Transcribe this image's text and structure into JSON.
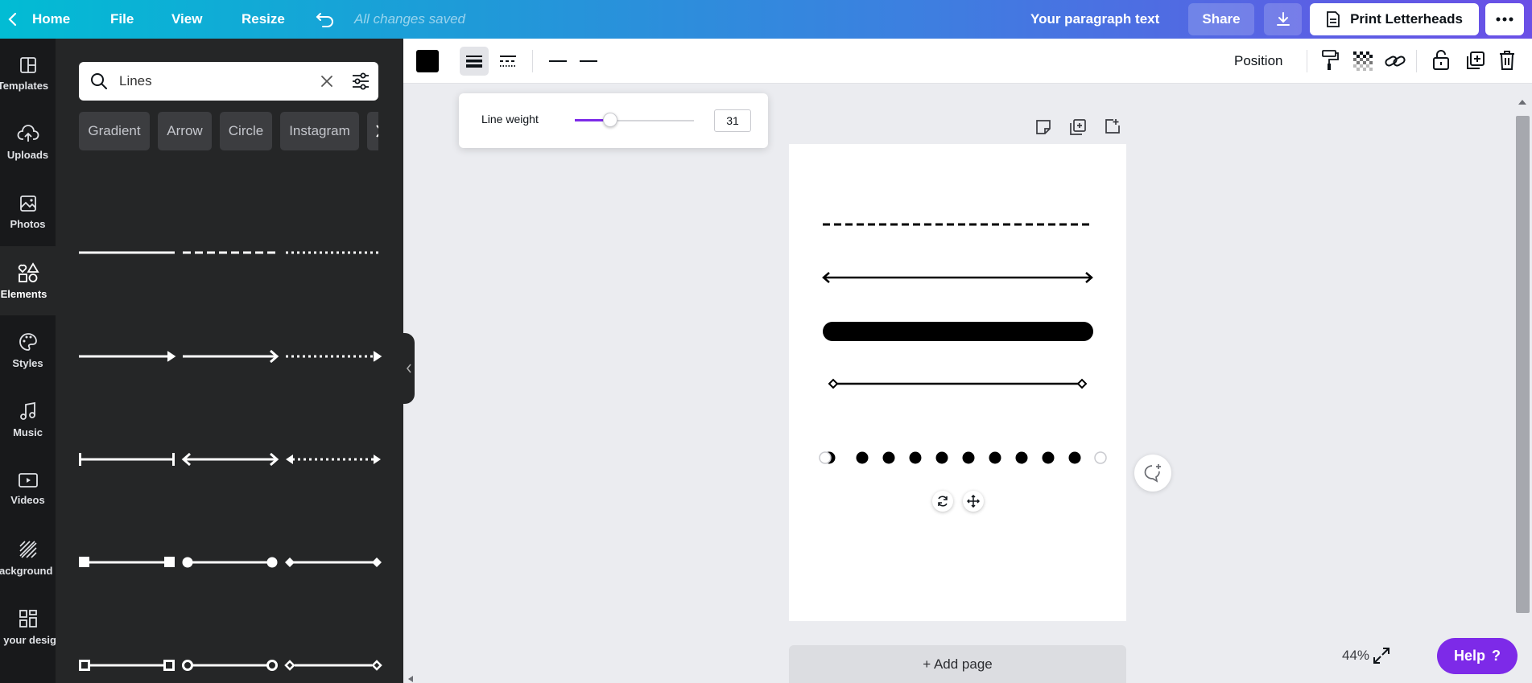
{
  "topbar": {
    "home_label": "Home",
    "file_label": "File",
    "view_label": "View",
    "resize_label": "Resize",
    "saved_status": "All changes saved",
    "doc_title": "Your paragraph text",
    "share_label": "Share",
    "print_label": "Print Letterheads"
  },
  "rail": {
    "items": [
      {
        "label": "Templates",
        "icon": "templates-icon"
      },
      {
        "label": "Uploads",
        "icon": "upload-cloud-icon"
      },
      {
        "label": "Photos",
        "icon": "photos-icon"
      },
      {
        "label": "Elements",
        "icon": "elements-icon",
        "active": true
      },
      {
        "label": "Styles",
        "icon": "palette-icon"
      },
      {
        "label": "Music",
        "icon": "music-icon"
      },
      {
        "label": "Videos",
        "icon": "video-icon"
      },
      {
        "label": "Background",
        "icon": "background-icon"
      },
      {
        "label": "All your designs",
        "icon": "designs-icon"
      }
    ]
  },
  "panel": {
    "search_value": "Lines",
    "chips": [
      "Gradient",
      "Arrow",
      "Circle",
      "Instagram"
    ]
  },
  "toolbar": {
    "position_label": "Position",
    "color": "#000000"
  },
  "popover": {
    "line_weight_label": "Line weight",
    "line_weight_value": "31",
    "slider_fraction": 0.3,
    "accent": "#7d2ae8"
  },
  "canvas": {
    "add_page_label": "+ Add page"
  },
  "zoom": {
    "level": "44%"
  },
  "help": {
    "label": "Help",
    "glyph": "?"
  }
}
